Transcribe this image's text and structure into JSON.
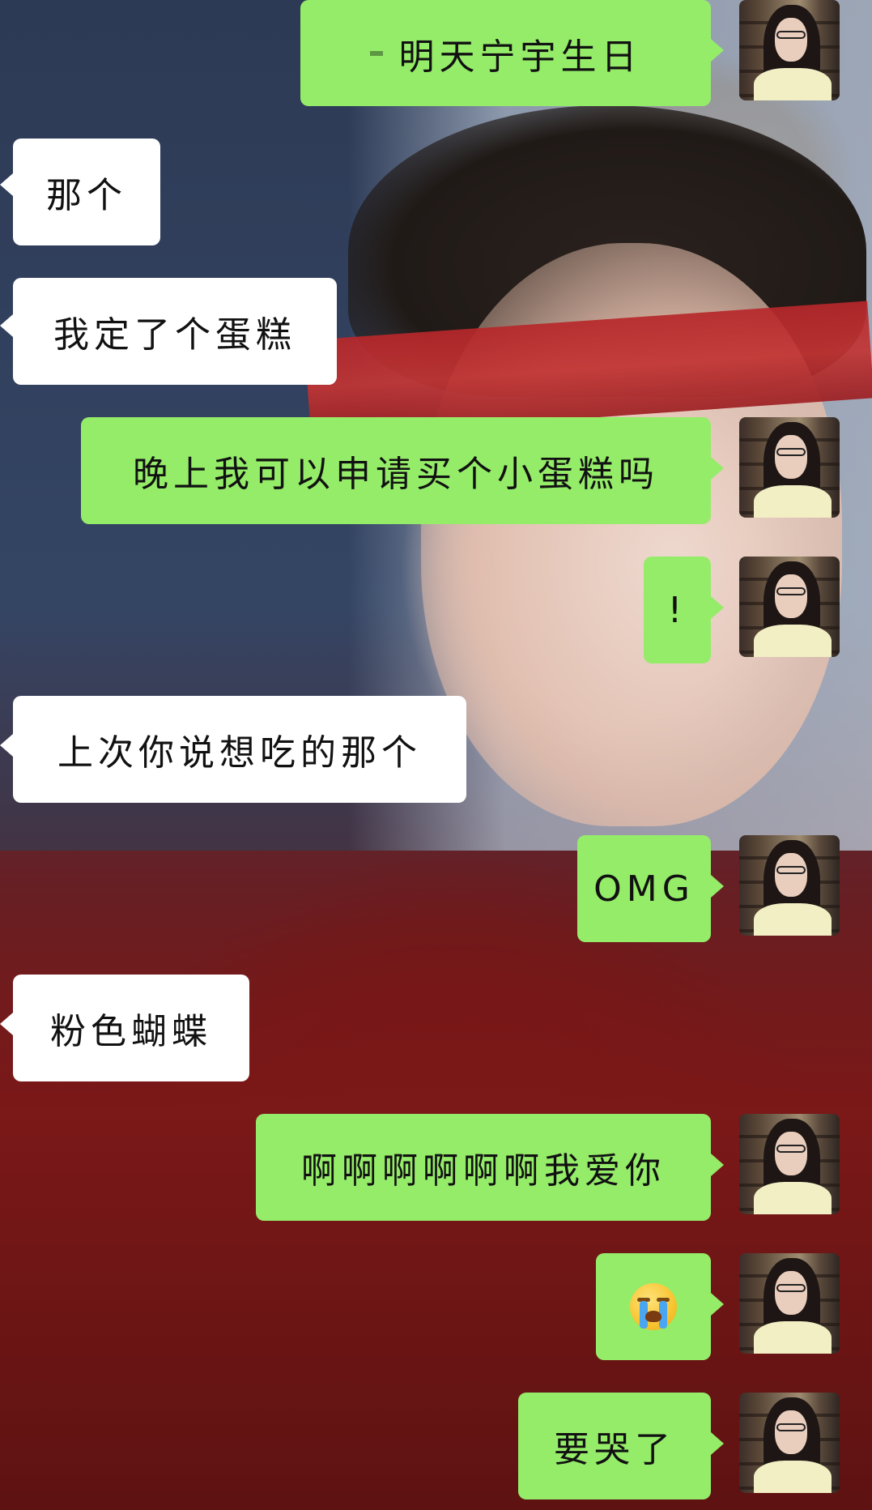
{
  "messages": [
    {
      "side": "out",
      "text": "明天宁宇生日",
      "prefix_blur": true
    },
    {
      "side": "in",
      "text": "那个"
    },
    {
      "side": "in",
      "text": "我定了个蛋糕"
    },
    {
      "side": "out",
      "text": "晚上我可以申请买个小蛋糕吗"
    },
    {
      "side": "out",
      "text": "!"
    },
    {
      "side": "in",
      "text": "上次你说想吃的那个"
    },
    {
      "side": "out",
      "text": "OMG"
    },
    {
      "side": "in",
      "text": "粉色蝴蝶"
    },
    {
      "side": "out",
      "text": "啊啊啊啊啊啊我爱你"
    },
    {
      "side": "out",
      "text": "",
      "emoji": "loudly-crying-face"
    },
    {
      "side": "out",
      "text": "要哭了"
    }
  ],
  "colors": {
    "outgoing_bubble": "#95ec69",
    "incoming_bubble": "#ffffff"
  }
}
